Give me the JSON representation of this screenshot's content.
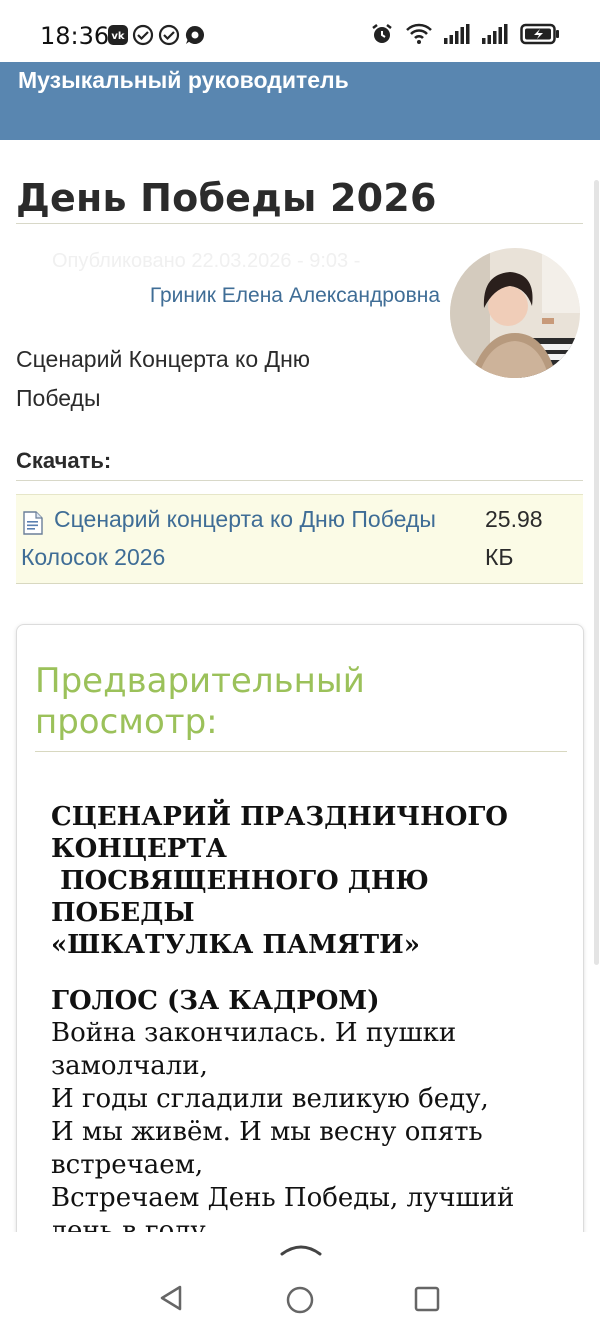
{
  "status_bar": {
    "time": "18:36",
    "left_icons": [
      "vk-icon",
      "check-circle-icon",
      "check-circle-icon",
      "chat-bubble-icon"
    ],
    "right_icons": [
      "alarm-icon",
      "wifi-icon",
      "signal-icon",
      "signal-icon",
      "battery-icon"
    ]
  },
  "header": {
    "site_title": "Музыкальный руководитель"
  },
  "article": {
    "title": "День Победы 2026",
    "published": "Опубликовано 22.03.2026 - 9:03 -",
    "author": "Гриник Елена Александровна",
    "description": "Сценарий Концерта ко Дню Победы"
  },
  "download": {
    "heading": "Скачать:",
    "file_name": "Сценарий концерта ко Дню Победы Колосок 2026",
    "file_size": "25.98 КБ",
    "file_icon": "document-icon"
  },
  "preview": {
    "heading": "Предварительный просмотр:",
    "doc_title": "СЦЕНАРИЙ ПРАЗДНИЧНОГО КОНЦЕРТА\n ПОСВЯЩЕННОГО ДНЮ ПОБЕДЫ\n«ШКАТУЛКА ПАМЯТИ»",
    "speaker": "ГОЛОС (ЗА КАДРОМ)",
    "text": "Война закончилась. И пушки замолчали,\nИ годы сгладили великую беду,\nИ мы живём. И мы весну опять встречаем,\nВстречаем День Победы, лучший день в году."
  },
  "colors": {
    "header_bg": "#5986b0",
    "link": "#3f6d96",
    "preview_heading": "#9bc15a",
    "download_bg": "#fbfbe6"
  }
}
